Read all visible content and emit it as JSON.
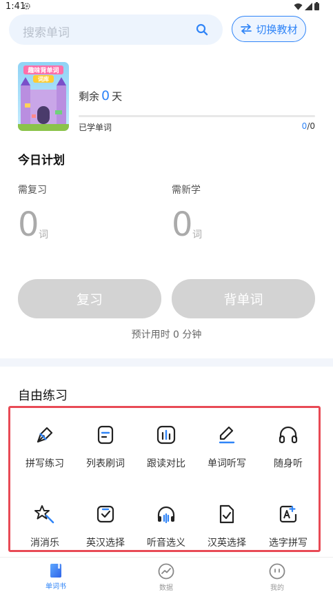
{
  "status_bar": {
    "time": "1:41"
  },
  "search": {
    "placeholder": "搜索单词"
  },
  "switch_button": {
    "label": "切换教材"
  },
  "book": {
    "remain_prefix": "剩余",
    "remain_days": "0",
    "remain_suffix": "天",
    "learned_label": "已学单词",
    "learned_current": "0",
    "learned_total": "/0",
    "progress_fraction": 0,
    "cover_title_line1": "趣味背单词",
    "cover_title_line2": "词库"
  },
  "plan": {
    "title": "今日计划",
    "review_label": "需复习",
    "review_value": "0",
    "review_unit": "词",
    "new_label": "需新学",
    "new_value": "0",
    "new_unit": "词",
    "review_button": "复习",
    "learn_button": "背单词",
    "estimate": "预计用时 0 分钟"
  },
  "free_practice": {
    "title": "自由练习",
    "items": [
      {
        "label": "拼写练习",
        "icon": "pen-nib-icon"
      },
      {
        "label": "列表刷词",
        "icon": "list-doc-icon"
      },
      {
        "label": "跟读对比",
        "icon": "bar-chart-icon"
      },
      {
        "label": "单词听写",
        "icon": "pencil-icon"
      },
      {
        "label": "随身听",
        "icon": "headphones-icon"
      },
      {
        "label": "消消乐",
        "icon": "star-wand-icon"
      },
      {
        "label": "英汉选择",
        "icon": "check-square-icon"
      },
      {
        "label": "听音选义",
        "icon": "audio-wave-icon"
      },
      {
        "label": "汉英选择",
        "icon": "check-doc-icon"
      },
      {
        "label": "选字拼写",
        "icon": "a-plus-icon"
      }
    ]
  },
  "bottom_nav": [
    {
      "label": "单词书",
      "icon": "book-icon",
      "active": true
    },
    {
      "label": "数据",
      "icon": "chart-circle-icon",
      "active": false
    },
    {
      "label": "我的",
      "icon": "smile-icon",
      "active": false
    }
  ],
  "colors": {
    "accent": "#2f84f7",
    "highlight_border": "#e84a55",
    "disabled_button": "#d3d3d3"
  }
}
